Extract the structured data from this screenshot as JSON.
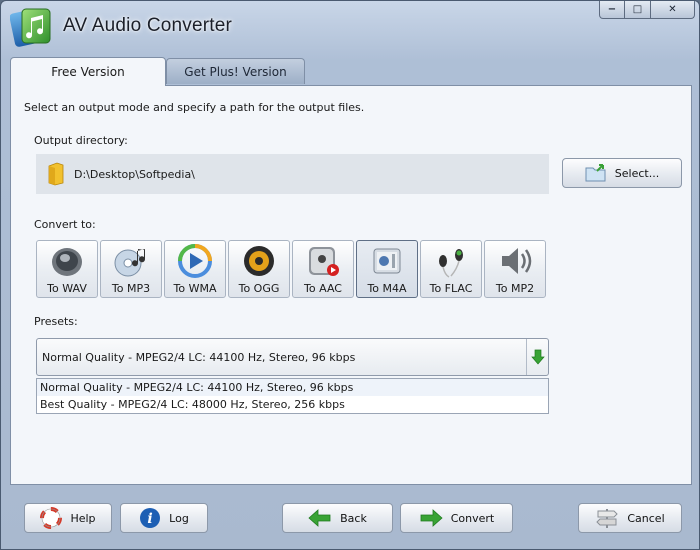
{
  "window": {
    "title": "AV Audio Converter",
    "controls": {
      "minimize": "−",
      "maximize": "□",
      "close": "✕"
    }
  },
  "tabs": [
    {
      "label": "Free Version",
      "active": true
    },
    {
      "label": "Get Plus! Version",
      "active": false
    }
  ],
  "main": {
    "intro": "Select an output mode and specify a path for the output files.",
    "output_directory_label": "Output directory:",
    "output_directory_value": "D:\\Desktop\\Softpedia\\",
    "select_button": "Select...",
    "convert_to_label": "Convert to:",
    "convert_buttons": [
      {
        "label": "To WAV",
        "icon": "speaker-icon",
        "selected": false
      },
      {
        "label": "To MP3",
        "icon": "cd-music-icon",
        "selected": false
      },
      {
        "label": "To WMA",
        "icon": "media-player-icon",
        "selected": false
      },
      {
        "label": "To OGG",
        "icon": "speaker-cone-icon",
        "selected": false
      },
      {
        "label": "To AAC",
        "icon": "apple-device-icon",
        "selected": false
      },
      {
        "label": "To M4A",
        "icon": "ipod-speaker-icon",
        "selected": true
      },
      {
        "label": "To FLAC",
        "icon": "earphones-icon",
        "selected": false
      },
      {
        "label": "To MP2",
        "icon": "volume-speaker-icon",
        "selected": false
      }
    ],
    "presets_label": "Presets:",
    "preset_selected": "Normal Quality - MPEG2/4 LC: 44100 Hz, Stereo, 96 kbps",
    "preset_options": [
      "Normal Quality - MPEG2/4 LC: 44100 Hz, Stereo, 96 kbps",
      "Best Quality - MPEG2/4 LC: 48000 Hz, Stereo, 256 kbps"
    ]
  },
  "bottom": {
    "help": "Help",
    "log": "Log",
    "back": "Back",
    "convert": "Convert",
    "cancel": "Cancel"
  },
  "colors": {
    "accent_green": "#39a335",
    "panel_bg": "#f3f6fa",
    "frame": "#aebfd6"
  }
}
